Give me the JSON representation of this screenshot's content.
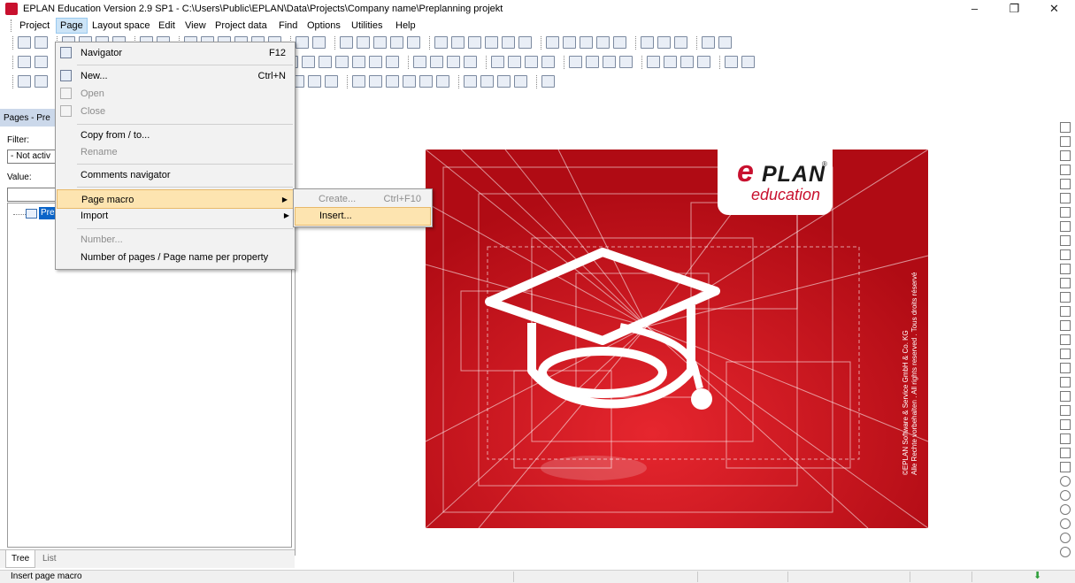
{
  "window": {
    "title": "EPLAN Education Version 2.9 SP1 - C:\\Users\\Public\\EPLAN\\Data\\Projects\\Company name\\Preplanning projekt",
    "minimize": "–",
    "restore": "❐",
    "close": "✕"
  },
  "menubar": [
    "Project",
    "Page",
    "Layout space",
    "Edit",
    "View",
    "Project data",
    "Find",
    "Options",
    "Utilities",
    "Help"
  ],
  "left_panel": {
    "title": "Pages - Pre",
    "filter_label": "Filter:",
    "filter_value": "- Not activ",
    "value_label": "Value:",
    "value_text": "",
    "tree_item": "Pre",
    "tabs": [
      "Tree",
      "List"
    ]
  },
  "page_menu": {
    "items": [
      {
        "label": "Navigator",
        "shortcut": "F12",
        "enabled": true
      },
      {
        "label": "New...",
        "shortcut": "Ctrl+N",
        "enabled": true
      },
      {
        "label": "Open",
        "shortcut": "",
        "enabled": false
      },
      {
        "label": "Close",
        "shortcut": "",
        "enabled": false
      },
      {
        "label": "Copy from / to...",
        "shortcut": "",
        "enabled": true
      },
      {
        "label": "Rename",
        "shortcut": "",
        "enabled": false
      },
      {
        "label": "Comments navigator",
        "shortcut": "",
        "enabled": true
      },
      {
        "label": "Page macro",
        "shortcut": "",
        "enabled": true
      },
      {
        "label": "Import",
        "shortcut": "",
        "enabled": true
      },
      {
        "label": "Number...",
        "shortcut": "",
        "enabled": false
      },
      {
        "label": "Number of pages / Page name per property",
        "shortcut": "",
        "enabled": true
      }
    ]
  },
  "macro_submenu": {
    "items": [
      {
        "label": "Create...",
        "shortcut": "Ctrl+F10",
        "enabled": false
      },
      {
        "label": "Insert...",
        "shortcut": "",
        "enabled": true
      }
    ]
  },
  "splash": {
    "logo_e": "e",
    "logo_plan": "PLAN",
    "logo_reg": "®",
    "logo_sub": "education",
    "copyright_line1": "©EPLAN Software & Service GmbH & Co. KG",
    "copyright_line2": "Alle Rechte vorbehalten . All rights reserved . Tous droits réservé"
  },
  "statusbar": {
    "text": "Insert page macro"
  },
  "colors": {
    "brand_red": "#c90f18",
    "menu_highlight": "#fde4b0",
    "panel_title": "#cbd8ea"
  }
}
